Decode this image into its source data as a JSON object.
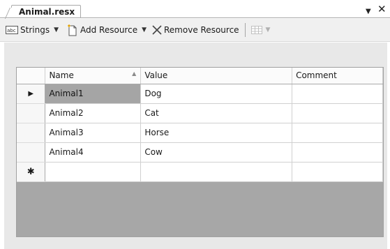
{
  "tab": {
    "title": "Animal.resx",
    "dropdown_icon": "down-triangle",
    "close_icon": "close-x"
  },
  "toolbar": {
    "strings_label": "Strings",
    "add_label": "Add Resource",
    "remove_label": "Remove Resource",
    "view_icon": "grid-view"
  },
  "grid": {
    "columns": [
      "Name",
      "Value",
      "Comment"
    ],
    "rows": [
      {
        "name": "Animal1",
        "value": "Dog",
        "comment": ""
      },
      {
        "name": "Animal2",
        "value": "Cat",
        "comment": ""
      },
      {
        "name": "Animal3",
        "value": "Horse",
        "comment": ""
      },
      {
        "name": "Animal4",
        "value": "Cow",
        "comment": ""
      }
    ],
    "current_row_marker": "▶",
    "new_row_marker": "✱"
  },
  "colors": {
    "selected_cell": "#a5a5a5",
    "grid_background": "#a7a7a7",
    "panel_background": "#e8e8e8"
  }
}
